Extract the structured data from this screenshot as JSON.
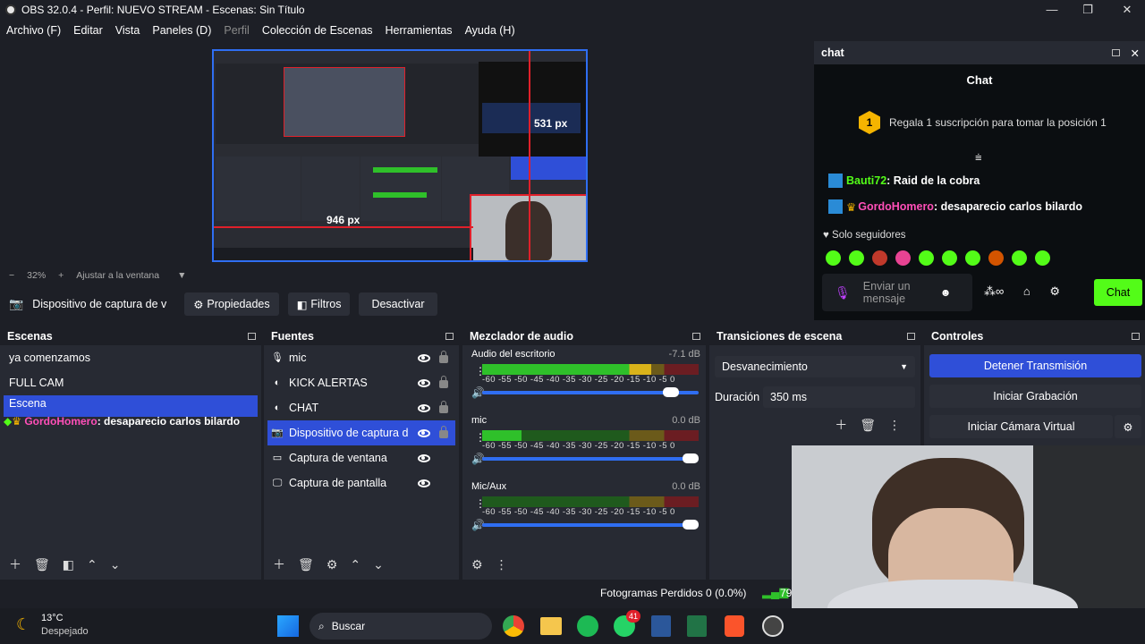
{
  "window": {
    "title": "OBS 32.0.4 - Perfil: NUEVO STREAM - Escenas: Sin Título",
    "min": "—",
    "max": "❐",
    "close": "✕"
  },
  "menu": [
    "Archivo (F)",
    "Editar",
    "Vista",
    "Paneles (D)",
    "Perfil",
    "Colección de Escenas",
    "Herramientas",
    "Ayuda (H)"
  ],
  "preview": {
    "height_px_label": "531 px",
    "width_px_label": "946 px"
  },
  "zoom": {
    "minus": "−",
    "level": "32%",
    "plus": "+",
    "fit": "Ajustar a la ventana"
  },
  "source_bar": {
    "source_name": "Dispositivo de captura de v",
    "properties": "Propiedades",
    "filters": "Filtros",
    "deactivate": "Desactivar"
  },
  "scenes": {
    "title": "Escenas",
    "items": [
      "ya comenzamos",
      "FULL CAM",
      "Escena"
    ],
    "overlay_user": "GordoHomero",
    "overlay_msg": ": desaparecio carlos bilardo"
  },
  "sources": {
    "title": "Fuentes",
    "items": [
      "mic",
      "KICK ALERTAS",
      "CHAT",
      "Dispositivo de captura d",
      "Captura de ventana",
      "Captura de pantalla"
    ]
  },
  "mixer": {
    "title": "Mezclador de audio",
    "tick_labels": "-60 -55 -50 -45 -40 -35 -30 -25 -20 -15 -10 -5 0",
    "channels": [
      {
        "name": "Audio del escritorio",
        "db": "-7.1 dB",
        "level": 0.78,
        "volume": 0.9
      },
      {
        "name": "mic",
        "db": "0.0 dB",
        "level": 0.18,
        "volume": 1.0
      },
      {
        "name": "Mic/Aux",
        "db": "0.0 dB",
        "level": 0.0,
        "volume": 1.0
      }
    ]
  },
  "transitions": {
    "title": "Transiciones de escena",
    "selected": "Desvanecimiento",
    "duration_label": "Duración",
    "duration_value": "350 ms"
  },
  "controls": {
    "title": "Controles",
    "stop_stream": "Detener Transmisión",
    "start_recording": "Iniciar Grabación",
    "virtual_cam": "Iniciar Cámara Virtual"
  },
  "chat": {
    "dock_title": "chat",
    "header": "Chat",
    "gift_rank": "1",
    "gift_text": "Regala 1 suscripción para tomar la posición 1",
    "messages": [
      {
        "user": "Bauti72",
        "text": ": Raid de la cobra",
        "color": "#53fc18"
      },
      {
        "user": "GordoHomero",
        "text": ": desaparecio carlos bilardo",
        "color": "#ff4fb8"
      }
    ],
    "followers_only": "Solo seguidores",
    "send_placeholder": "Enviar un mensaje",
    "send_button": "Chat",
    "accent": "#53fc18"
  },
  "status": {
    "dropped_frames": "Fotogramas Perdidos 0 (0.0%)",
    "partial": "79"
  },
  "taskbar": {
    "temperature": "13°C",
    "weather": "Despejado",
    "search": "Buscar",
    "whatsapp_badge": "41"
  }
}
